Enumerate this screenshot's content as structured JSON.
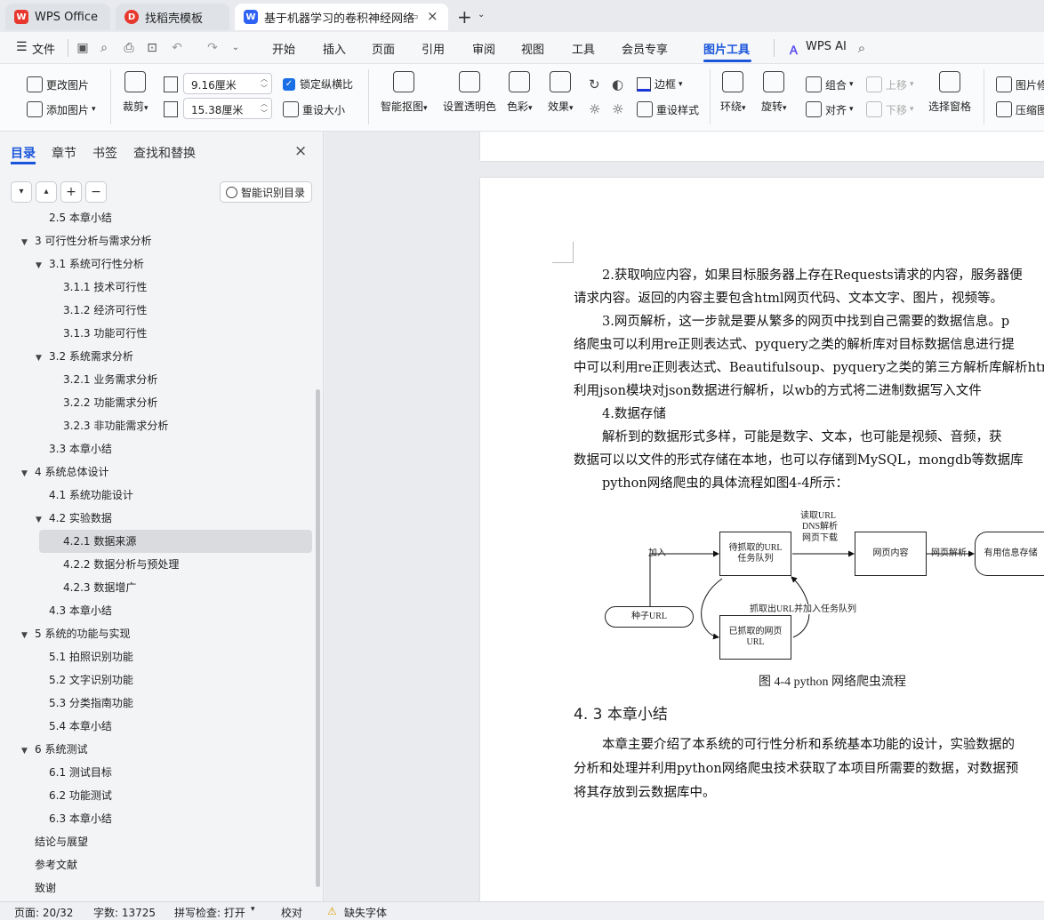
{
  "tabs": [
    {
      "label": "WPS Office",
      "icon": "wps-logo-icon",
      "color": "#e8382e"
    },
    {
      "label": "找稻壳模板",
      "icon": "docer-icon",
      "color": "#e8382e"
    },
    {
      "label": "基于机器学习的卷积神经网络",
      "icon": "writer-doc-icon",
      "color": "#2f62f5"
    }
  ],
  "menu": {
    "file": "文件",
    "items": [
      "开始",
      "插入",
      "页面",
      "引用",
      "审阅",
      "视图",
      "工具",
      "会员专享",
      "图片工具"
    ],
    "active": "图片工具",
    "ai": "WPS AI"
  },
  "ribbon": {
    "change_image": "更改图片",
    "add_image": "添加图片",
    "crop": "裁剪",
    "height_value": "9.16厘米",
    "width_value": "15.38厘米",
    "lock_ratio": "锁定纵横比",
    "resize": "重设大小",
    "smart_cutout": "智能抠图",
    "transparent": "设置透明色",
    "color": "色彩",
    "effect": "效果",
    "border": "边框",
    "reset_style": "重设样式",
    "wrap": "环绕",
    "rotate": "旋转",
    "group": "组合",
    "align": "对齐",
    "move_up": "上移",
    "move_down": "下移",
    "select_pane": "选择窗格",
    "image_fix": "图片修",
    "compress": "压缩图"
  },
  "nav": {
    "tabs": [
      "目录",
      "章节",
      "书签",
      "查找和替换"
    ],
    "smart_toc": "智能识别目录",
    "toc": [
      {
        "label": "2.5  本章小结",
        "level": 2
      },
      {
        "label": "3 可行性分析与需求分析",
        "level": 1,
        "arrow": true
      },
      {
        "label": "3.1  系统可行性分析",
        "level": 2,
        "arrow": true
      },
      {
        "label": "3.1.1 技术可行性",
        "level": 3
      },
      {
        "label": "3.1.2 经济可行性",
        "level": 3
      },
      {
        "label": "3.1.3 功能可行性",
        "level": 3
      },
      {
        "label": "3.2  系统需求分析",
        "level": 2,
        "arrow": true
      },
      {
        "label": "3.2.1  业务需求分析",
        "level": 3
      },
      {
        "label": "3.2.2  功能需求分析",
        "level": 3
      },
      {
        "label": "3.2.3  非功能需求分析",
        "level": 3
      },
      {
        "label": "3.3  本章小结",
        "level": 2
      },
      {
        "label": "4  系统总体设计",
        "level": 1,
        "arrow": true
      },
      {
        "label": "4.1  系统功能设计",
        "level": 2
      },
      {
        "label": "4.2  实验数据",
        "level": 2,
        "arrow": true
      },
      {
        "label": "4.2.1  数据来源",
        "level": 3,
        "selected": true
      },
      {
        "label": "4.2.2  数据分析与预处理",
        "level": 3
      },
      {
        "label": "4.2.3  数据增广",
        "level": 3
      },
      {
        "label": "4.3  本章小结",
        "level": 2
      },
      {
        "label": "5  系统的功能与实现",
        "level": 1,
        "arrow": true
      },
      {
        "label": "5.1  拍照识别功能",
        "level": 2
      },
      {
        "label": "5.2  文字识别功能",
        "level": 2
      },
      {
        "label": "5.3  分类指南功能",
        "level": 2
      },
      {
        "label": "5.4  本章小结",
        "level": 2
      },
      {
        "label": "6  系统测试",
        "level": 1,
        "arrow": true
      },
      {
        "label": "6.1  测试目标",
        "level": 2
      },
      {
        "label": "6.2  功能测试",
        "level": 2
      },
      {
        "label": "6.3  本章小结",
        "level": 2
      },
      {
        "label": "结论与展望",
        "level": 1
      },
      {
        "label": "参考文献",
        "level": 1
      },
      {
        "label": "致谢",
        "level": 1
      }
    ]
  },
  "doc": {
    "paragraphs": [
      "2.获取响应内容，如果目标服务器上存在Requests请求的内容，服务器便",
      "请求内容。返回的内容主要包含html网页代码、文本文字、图片，视频等。",
      "3.网页解析，这一步就是要从繁多的网页中找到自己需要的数据信息。p",
      "络爬虫可以利用re正则表达式、pyquery之类的解析库对目标数据信息进行提",
      "中可以利用re正则表达式、Beautifulsoup、pyquery之类的第三方解析库解析htm",
      "利用json模块对json数据进行解析，以wb的方式将二进制数据写入文件",
      "4.数据存储",
      "解析到的数据形式多样，可能是数字、文本，也可能是视频、音频，获",
      "数据可以以文件的形式存储在本地，也可以存储到MySQL，mongdb等数据库",
      "python网络爬虫的具体流程如图4-4所示："
    ],
    "diagram": {
      "seed": "种子URL",
      "add": "加入",
      "queue": "待抓取的URL\n任务队列",
      "read_url": "读取URL",
      "dns": "DNS解析",
      "download": "网页下载",
      "content": "网页内容",
      "parse": "网页解析",
      "storage": "有用信息存储",
      "crawled": "已抓取的网页\nURL",
      "extract": "抓取出URL并加入任务队列"
    },
    "caption": "图 4-4 python 网络爬虫流程",
    "section_heading": "4. 3  本章小结",
    "summary": [
      "本章主要介绍了本系统的可行性分析和系统基本功能的设计，实验数据的",
      "分析和处理并利用python网络爬虫技术获取了本项目所需要的数据，对数据预",
      "将其存放到云数据库中。"
    ]
  },
  "status": {
    "page": "页面: 20/32",
    "words": "字数: 13725",
    "spell": "拼写检查: 打开",
    "proof": "校对",
    "missing_font": "缺失字体"
  }
}
